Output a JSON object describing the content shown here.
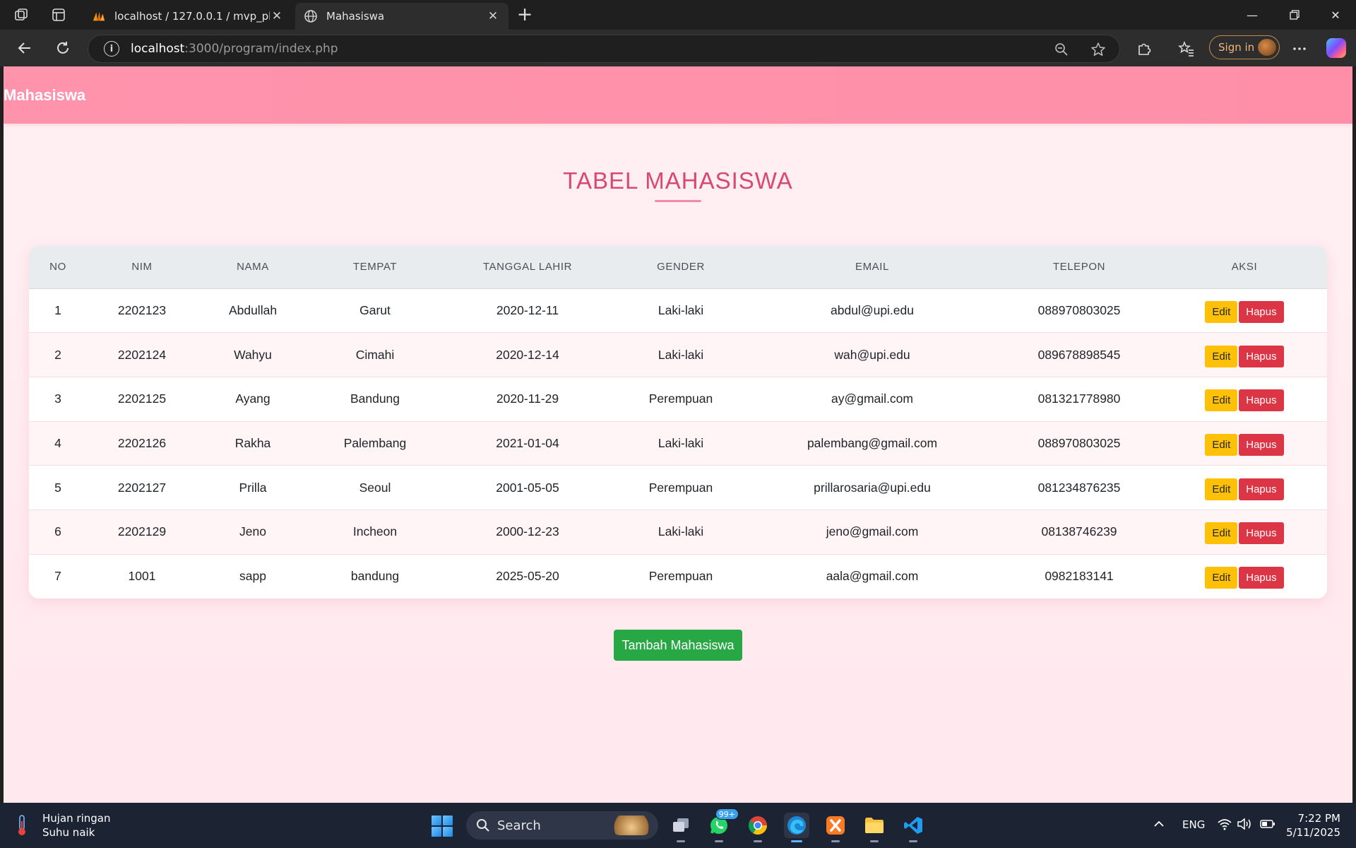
{
  "browser": {
    "tabs": [
      {
        "title": "localhost / 127.0.0.1 / mvp_php / ",
        "active": false
      },
      {
        "title": "Mahasiswa",
        "active": true
      }
    ],
    "url_host": "localhost",
    "url_rest": ":3000/program/index.php",
    "sign_in_label": "Sign in"
  },
  "app": {
    "brand": "Mahasiswa",
    "page_title": "TABEL MAHASISWA",
    "columns": [
      "NO",
      "NIM",
      "NAMA",
      "TEMPAT",
      "TANGGAL LAHIR",
      "GENDER",
      "EMAIL",
      "TELEPON",
      "AKSI"
    ],
    "rows": [
      {
        "no": "1",
        "nim": "2202123",
        "nama": "Abdullah",
        "tempat": "Garut",
        "tanggal_lahir": "2020-12-11",
        "gender": "Laki-laki",
        "email": "abdul@upi.edu",
        "telepon": "088970803025"
      },
      {
        "no": "2",
        "nim": "2202124",
        "nama": "Wahyu",
        "tempat": "Cimahi",
        "tanggal_lahir": "2020-12-14",
        "gender": "Laki-laki",
        "email": "wah@upi.edu",
        "telepon": "089678898545"
      },
      {
        "no": "3",
        "nim": "2202125",
        "nama": "Ayang",
        "tempat": "Bandung",
        "tanggal_lahir": "2020-11-29",
        "gender": "Perempuan",
        "email": "ay@gmail.com",
        "telepon": "081321778980"
      },
      {
        "no": "4",
        "nim": "2202126",
        "nama": "Rakha",
        "tempat": "Palembang",
        "tanggal_lahir": "2021-01-04",
        "gender": "Laki-laki",
        "email": "palembang@gmail.com",
        "telepon": "088970803025"
      },
      {
        "no": "5",
        "nim": "2202127",
        "nama": "Prilla",
        "tempat": "Seoul",
        "tanggal_lahir": "2001-05-05",
        "gender": "Perempuan",
        "email": "prillarosaria@upi.edu",
        "telepon": "081234876235"
      },
      {
        "no": "6",
        "nim": "2202129",
        "nama": "Jeno",
        "tempat": "Incheon",
        "tanggal_lahir": "2000-12-23",
        "gender": "Laki-laki",
        "email": "jeno@gmail.com",
        "telepon": "08138746239"
      },
      {
        "no": "7",
        "nim": "1001",
        "nama": "sapp",
        "tempat": "bandung",
        "tanggal_lahir": "2025-05-20",
        "gender": "Perempuan",
        "email": "aala@gmail.com",
        "telepon": "0982183141"
      }
    ],
    "edit_label": "Edit",
    "delete_label": "Hapus",
    "add_button": "Tambah Mahasiswa"
  },
  "colors": {
    "navbar": "#ff93ac",
    "title": "#d9486f",
    "edit": "#ffc107",
    "delete": "#dc3545",
    "add": "#28a745"
  },
  "taskbar": {
    "weather_line1": "Hujan ringan",
    "weather_line2": "Suhu naik",
    "search_label": "Search",
    "whatsapp_badge": "99+",
    "language": "ENG",
    "time": "7:22 PM",
    "date": "5/11/2025",
    "apps": [
      "task-view-icon",
      "whatsapp-icon",
      "chrome-icon",
      "edge-icon",
      "xampp-icon",
      "file-explorer-icon",
      "vscode-icon"
    ]
  }
}
